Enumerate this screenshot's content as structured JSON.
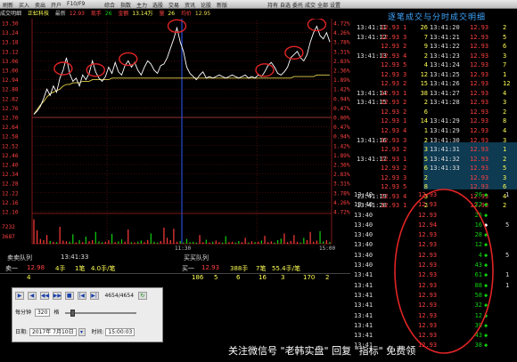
{
  "toolbar": {
    "items": [
      "刷新",
      "买入",
      "卖出",
      "开户",
      "F10/F9",
      "综合",
      "指数",
      "主力",
      "选股",
      "交易",
      "资讯",
      "论股",
      "新版"
    ],
    "tabs": [
      "持有",
      "自选",
      "委托",
      "成交",
      "全部",
      "设置"
    ]
  },
  "header": {
    "chart_title": "成交明细",
    "stock_name": "正虹科技",
    "latest_label": "最新",
    "latest_value": "12.93",
    "hand_label": "现手",
    "hand_value": "26",
    "amount_label": "金额",
    "amount_value": "13.14万",
    "volume_label": "量",
    "volume_value": "26",
    "avg_label": "均价",
    "avg_value": "12.95"
  },
  "price_axis": {
    "labels": [
      "13.30",
      "13.24",
      "13.18",
      "13.12",
      "13.06",
      "13.00",
      "12.94",
      "12.88",
      "12.82",
      "12.76",
      "12.70",
      "12.64",
      "12.58",
      "12.52",
      "12.46",
      "12.40",
      "12.34",
      "12.28",
      "12.22",
      "12.16",
      "12.10"
    ],
    "pct_labels": [
      "4.72%",
      "4.26%",
      "3.78%",
      "3.31%",
      "2.83%",
      "2.36%",
      "1.89%",
      "1.42%",
      "0.94%",
      "0.47%",
      "0.00%",
      "0.47%",
      "0.94%",
      "1.42%",
      "1.89%",
      "2.36%",
      "2.83%",
      "3.31%",
      "3.78%",
      "4.26%",
      "4.72%"
    ],
    "vol_labels": [
      "7232",
      "3687"
    ],
    "time_mid": "11:30",
    "time_end": "15:00"
  },
  "chart_data": {
    "type": "line",
    "title": "",
    "ylim": [
      12.1,
      13.3
    ],
    "prev_close": 12.7,
    "series": [
      {
        "values": [
          12.72,
          12.74,
          12.77,
          12.82,
          12.88,
          12.84,
          12.9,
          12.86,
          12.95,
          13.0,
          13.08,
          12.98,
          12.93,
          12.95,
          12.9,
          12.97,
          12.94,
          12.98,
          13.06,
          12.99,
          12.95,
          12.93,
          12.96,
          13.02,
          12.98,
          13.05,
          12.99,
          12.97,
          13.03,
          13.06,
          13.02,
          13.05,
          13.0,
          12.97,
          13.02,
          13.06,
          13.04,
          13.0,
          12.98,
          13.03,
          13.04,
          13.08,
          13.14,
          13.2,
          13.27,
          13.18,
          13.12,
          13.02,
          12.98,
          12.96,
          12.94,
          12.97,
          12.99,
          12.95,
          12.96,
          12.95,
          12.96,
          12.97,
          12.96,
          12.95,
          12.96,
          12.97,
          12.96,
          12.95,
          12.96,
          12.97,
          12.95,
          12.96,
          12.95,
          12.97,
          12.96,
          12.99,
          13.03,
          13.05,
          13.02,
          12.98,
          12.97,
          12.99,
          13.02,
          13.08,
          13.1,
          13.12,
          13.08,
          13.06,
          13.1,
          13.18,
          13.24,
          13.28,
          13.22,
          13.2,
          13.24,
          13.18
        ]
      },
      {
        "values": [
          12.72,
          12.75,
          12.78,
          12.8,
          12.83,
          12.85,
          12.86,
          12.87,
          12.88,
          12.9,
          12.91,
          12.91,
          12.92,
          12.92,
          12.92,
          12.93,
          12.93,
          12.93,
          12.94,
          12.94,
          12.94,
          12.94,
          12.94,
          12.94,
          12.95,
          12.95,
          12.95,
          12.95,
          12.95,
          12.95,
          12.95,
          12.95,
          12.95,
          12.95,
          12.95,
          12.95,
          12.95,
          12.95,
          12.95,
          12.95,
          12.95,
          12.95,
          12.95,
          12.95,
          12.95,
          12.95,
          12.95,
          12.95,
          12.95,
          12.95,
          12.95,
          12.95,
          12.95,
          12.95,
          12.95,
          12.95,
          12.95,
          12.95,
          12.95,
          12.95,
          12.95,
          12.95,
          12.95,
          12.95,
          12.95,
          12.95,
          12.95,
          12.95,
          12.95,
          12.95,
          12.95,
          12.95,
          12.95,
          12.95,
          12.95,
          12.95,
          12.95,
          12.95,
          12.95,
          12.95,
          12.96,
          12.96,
          12.96,
          12.96,
          12.96,
          12.96,
          12.96,
          12.97,
          12.97,
          12.97,
          12.97,
          12.97
        ]
      }
    ],
    "volume_ylim": [
      0,
      7232
    ],
    "volume": [
      6200,
      3400,
      1200,
      900,
      2200,
      700,
      500,
      400,
      4300,
      800,
      600,
      500,
      2400,
      300,
      900,
      400,
      1800,
      600,
      900,
      3000,
      600,
      400,
      500,
      900,
      2500,
      400,
      600,
      1100,
      500,
      3600,
      400,
      300,
      500,
      800,
      400,
      900,
      2600,
      500,
      300,
      700,
      4100,
      1500,
      900,
      3800,
      500,
      700,
      300,
      1200,
      400,
      500,
      300,
      2200,
      400,
      1000,
      300,
      500,
      800,
      400,
      300,
      1900,
      400,
      500,
      300,
      700,
      400,
      1500,
      300,
      600,
      400,
      500,
      800,
      2000,
      400,
      600,
      300,
      900,
      1300,
      2600,
      400,
      700,
      2200,
      500,
      300,
      1500,
      900,
      3000,
      500,
      800,
      3200,
      600,
      900,
      400
    ]
  },
  "right_panel": {
    "title": "逐笔成交与分时成交明细",
    "left_columns": {
      "times": [
        "13:41:11",
        "13:41:12",
        "",
        "13:41:13",
        "",
        "",
        "",
        "13:41:14",
        "13:41:15",
        "",
        "",
        "",
        "13:41:16",
        "",
        "13:41:17",
        "",
        "",
        "",
        "13:41:19",
        "13:41:20"
      ],
      "prices": [
        "12.93",
        "12.93",
        "12.93",
        "12.93",
        "12.93",
        "12.93",
        "12.93",
        "12.93",
        "12.93",
        "12.93",
        "12.93",
        "12.93",
        "12.93",
        "12.93",
        "12.93",
        "12.93",
        "12.93",
        "12.93",
        "12.93",
        "12.93"
      ],
      "vols": [
        "1",
        "3",
        "2",
        "4",
        "5",
        "3",
        "2",
        "1",
        "2",
        "2",
        "1",
        "4",
        "3",
        "2",
        "1",
        "2",
        "3",
        "5",
        "4",
        "1"
      ]
    },
    "right_columns": {
      "counts": [
        "26",
        "7",
        "9",
        "2",
        "4",
        "12",
        "15",
        "38",
        "2",
        "6",
        "14",
        "1",
        "2",
        "3",
        "5",
        "6",
        "2",
        "8",
        "3",
        "2"
      ],
      "times": [
        "13:41:20",
        "13:41:21",
        "13:41:22",
        "13:41:23",
        "13:41:24",
        "13:41:25",
        "13:41:26",
        "13:41:27",
        "13:41:28",
        "",
        "13:41:29",
        "13:41:29",
        "13:41:30",
        "13:41:31",
        "13:41:32",
        "13:41:33",
        "",
        "",
        "",
        ""
      ],
      "prices": [
        "12.93",
        "12.93",
        "12.93",
        "12.93",
        "12.93",
        "12.93",
        "12.93",
        "12.93",
        "12.93",
        "12.93",
        "12.93",
        "12.93",
        "12.93",
        "12.93",
        "12.93",
        "12.93",
        "12.93",
        "12.93",
        "12.93",
        "12.93"
      ],
      "vols": [
        "2",
        "5",
        "6",
        "3",
        "7",
        "1",
        "12",
        "4",
        "3",
        "2",
        "8",
        "4",
        "3",
        "1",
        "2",
        "5",
        "3",
        "6",
        "4",
        "2"
      ]
    },
    "bottom_list": {
      "times": [
        "13:40",
        "13:40",
        "13:40",
        "13:40",
        "13:40",
        "13:40",
        "13:40",
        "13:40",
        "13:41",
        "13:41",
        "13:41",
        "13:41",
        "13:41",
        "13:41",
        "13:41",
        "13:41"
      ],
      "prices": [
        "12.93",
        "12.93",
        "12.93",
        "12.94",
        "12.93",
        "12.93",
        "12.93",
        "12.93",
        "12.93",
        "12.93",
        "12.93",
        "12.93",
        "12.93",
        "12.93",
        "12.93",
        "12.93"
      ],
      "vols": [
        "26",
        "22",
        "26",
        "16",
        "28",
        "12",
        "4",
        "43",
        "61",
        "88",
        "58",
        "32",
        "12",
        "39",
        "43",
        "38"
      ],
      "dirs": [
        "down",
        "down",
        "down",
        "neutral",
        "down",
        "down",
        "down",
        "down",
        "down",
        "down",
        "down",
        "down",
        "down",
        "down",
        "down",
        "down"
      ],
      "counts": [
        "1",
        "",
        "",
        "5",
        "",
        "",
        "5",
        "",
        "1",
        "1",
        "",
        "",
        "",
        "",
        "",
        ""
      ]
    }
  },
  "queue": {
    "sell_label": "卖卖队列",
    "time_label": "13:41:33",
    "buy_label": "买买队列",
    "sell1_label": "卖一",
    "sell1_price": "12.98",
    "sell1_hands": "4手",
    "sell1_count": "1笔",
    "sell1_avg": "4.0手/笔",
    "buy1_label": "买一",
    "buy1_price": "12.93",
    "buy1_hands": "388手",
    "buy1_count": "7笔",
    "buy1_avg": "55.4手/笔",
    "sell_queue": [
      "4"
    ],
    "buy_queue": [
      "186",
      "5",
      "6",
      "16",
      "3",
      "170",
      "2"
    ]
  },
  "player": {
    "counter": "4654/4654",
    "per_minute_label": "每分钟",
    "per_minute_value": "320",
    "per_minute_unit": "格",
    "date_label": "日期:",
    "date_value": "2017年 7月10日",
    "time_label": "时间:",
    "time_value": "15:00:03"
  },
  "watermark": "关注微信号 \"老韩实盘\" 回复 \"指标\" 免费领",
  "colors": {
    "up": "#ff3b3b",
    "down": "#10d010",
    "price_line": "#ffffff",
    "avg_line": "#e7d24a",
    "grid": "#7a1414",
    "axis_text": "#ff4040",
    "highlight": "#0e3a52",
    "annotation": "#e02424"
  }
}
